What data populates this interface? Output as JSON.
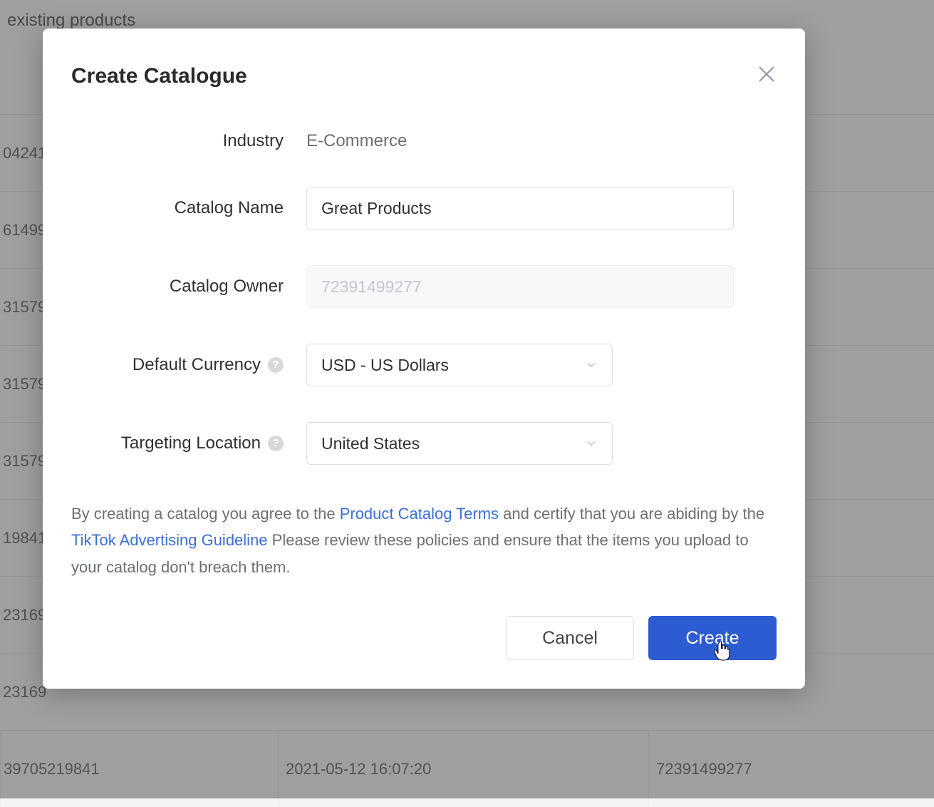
{
  "background": {
    "header_text": "existing products",
    "rows": [
      {
        "c1": "04241",
        "c2": "",
        "c3": ""
      },
      {
        "c1": "61499",
        "c2": "",
        "c3": ""
      },
      {
        "c1": "31579",
        "c2": "",
        "c3": ""
      },
      {
        "c1": "31579",
        "c2": "",
        "c3": ""
      },
      {
        "c1": "31579",
        "c2": "",
        "c3": ""
      },
      {
        "c1": "19841",
        "c2": "",
        "c3": ""
      },
      {
        "c1": "23169",
        "c2": "",
        "c3": ""
      },
      {
        "c1": "23169",
        "c2": "",
        "c3": ""
      },
      {
        "c1": "39705219841",
        "c2": "2021-05-12 16:07:20",
        "c3": "72391499277"
      }
    ]
  },
  "modal": {
    "title": "Create Catalogue",
    "labels": {
      "industry": "Industry",
      "catalog_name": "Catalog Name",
      "catalog_owner": "Catalog Owner",
      "default_currency": "Default Currency",
      "targeting_location": "Targeting Location"
    },
    "values": {
      "industry": "E-Commerce",
      "catalog_name": "Great Products",
      "catalog_owner": "72391499277",
      "default_currency": "USD - US Dollars",
      "targeting_location": "United States"
    },
    "disclaimer": {
      "part1": "By creating a catalog you agree to the ",
      "link1": "Product Catalog Terms",
      "part2": " and certify that you are abiding by the ",
      "link2": "TikTok Advertising Guideline",
      "part3": " Please review these policies and ensure that the items you upload to your catalog don't breach them."
    },
    "buttons": {
      "cancel": "Cancel",
      "create": "Create"
    }
  }
}
